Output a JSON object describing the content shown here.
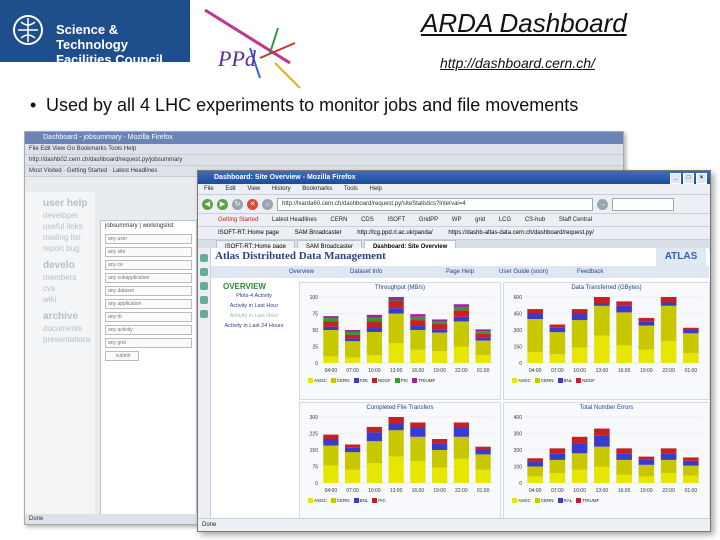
{
  "slide": {
    "org_name": "Science & Technology\nFacilities Council",
    "group_logo": "PPd",
    "title": "ARDA Dashboard",
    "url": "http://dashboard.cern.ch/",
    "bullet": "Used by all 4 LHC experiments to monitor jobs and file movements"
  },
  "back_window": {
    "title": "Dashboard - jobsummary - Mozilla Firefox",
    "menu": "File  Edit  View  Go  Bookmarks  Tools  Help",
    "address": "http://dashb02.cern.ch/dashboard/request.py/jobsummary",
    "links": [
      "Most Visited",
      "Getting Started",
      "Latest Headlines"
    ],
    "sidebar_items": [
      {
        "heading": "user help",
        "subs": [
          "developer",
          "useful links",
          "mailing list",
          "report bug"
        ]
      },
      {
        "heading": "develo",
        "subs": [
          "members",
          "cvs",
          "wiki"
        ]
      },
      {
        "heading": "archive",
        "subs": [
          "documents",
          "presentations"
        ]
      }
    ],
    "form_tabs": [
      "jobsummary",
      "workingslist"
    ],
    "form_rows": [
      "any user",
      "any site",
      "any ce",
      "any subapplication",
      "any dataset",
      "any application",
      "any rb",
      "any activity",
      "any grid"
    ],
    "submit": "submit",
    "status": "Done"
  },
  "front_window": {
    "title": "Dashboard: Site Overview - Mozilla Firefox",
    "menu": [
      "File",
      "Edit",
      "View",
      "History",
      "Bookmarks",
      "Tools",
      "Help"
    ],
    "address": "http://lxarda60.cern.ch/dashboard/request.py/siteStatistics?interval=4",
    "bookmarks": [
      "Getting Started",
      "Latest Headlines",
      "CERN",
      "CDS",
      "ISOFT",
      "GridPP",
      "WP",
      "grid",
      "LCG",
      "CS-hub",
      "Staff Central"
    ],
    "links": [
      "ISOFT-RT::Home page",
      "SAM Broadcaster",
      "http://lcg.ppd.rl.ac.uk/panda/",
      "https://dashb-atlas-data.cern.ch/dashboard/request.py/"
    ],
    "tabs": [
      {
        "label": "ISOFT-RT::Home page",
        "active": false
      },
      {
        "label": "SAM Broadcaster",
        "active": false
      },
      {
        "label": "Dashboard: Site Overview",
        "active": true
      }
    ],
    "page_title": "Atlas Distributed Data Management",
    "brand": "ATLAS",
    "nav": [
      "Overview",
      "Dataset Info",
      "Page Help",
      "User Guide (soon)",
      "Feedback"
    ],
    "overview_heading": "OVERVIEW",
    "overview_links": [
      {
        "label": "Plots-4 Activity",
        "dim": false
      },
      {
        "label": "Activity in Last Hour",
        "dim": false
      },
      {
        "label": "Activity in Last Hour",
        "dim": true
      },
      {
        "label": "Activity in Last 24 Hours",
        "dim": false
      }
    ],
    "status": "Done"
  },
  "chart_data": [
    {
      "type": "bar",
      "title": "Throughput (MB/s)",
      "categories": [
        "04:00",
        "07:00",
        "10:00",
        "13:00",
        "16:00",
        "19:00",
        "22:00",
        "01:00"
      ],
      "series": [
        {
          "name": "ASGC",
          "values": [
            10,
            8,
            12,
            30,
            20,
            18,
            25,
            12
          ]
        },
        {
          "name": "CERN",
          "values": [
            40,
            25,
            35,
            45,
            30,
            28,
            38,
            22
          ]
        },
        {
          "name": "FZK",
          "values": [
            5,
            4,
            6,
            8,
            6,
            5,
            7,
            4
          ]
        },
        {
          "name": "NDGF",
          "values": [
            8,
            6,
            10,
            12,
            9,
            8,
            10,
            6
          ]
        },
        {
          "name": "PIC",
          "values": [
            5,
            4,
            6,
            6,
            5,
            4,
            5,
            4
          ]
        },
        {
          "name": "TRIUMF",
          "values": [
            3,
            3,
            4,
            5,
            4,
            3,
            4,
            3
          ]
        }
      ],
      "ylim": [
        0,
        100
      ]
    },
    {
      "type": "bar",
      "title": "Data Transferred (GBytes)",
      "categories": [
        "04:00",
        "07:00",
        "10:00",
        "13:00",
        "16:00",
        "19:00",
        "22:00",
        "01:00"
      ],
      "series": [
        {
          "name": "ASGC",
          "values": [
            100,
            80,
            140,
            400,
            160,
            120,
            200,
            90
          ]
        },
        {
          "name": "CERN",
          "values": [
            300,
            200,
            250,
            350,
            300,
            220,
            320,
            180
          ]
        },
        {
          "name": "BNL",
          "values": [
            50,
            40,
            60,
            80,
            60,
            40,
            70,
            30
          ]
        },
        {
          "name": "NDGF",
          "values": [
            40,
            30,
            40,
            60,
            40,
            30,
            50,
            20
          ]
        }
      ],
      "ylim": [
        0,
        600
      ]
    },
    {
      "type": "bar",
      "title": "Completed File Transfers",
      "categories": [
        "04:00",
        "07:00",
        "10:00",
        "13:00",
        "16:00",
        "19:00",
        "22:00",
        "01:00"
      ],
      "series": [
        {
          "name": "ASGC",
          "values": [
            80,
            60,
            90,
            120,
            100,
            70,
            110,
            60
          ]
        },
        {
          "name": "CERN",
          "values": [
            90,
            80,
            100,
            120,
            110,
            80,
            100,
            70
          ]
        },
        {
          "name": "BNL",
          "values": [
            30,
            20,
            40,
            50,
            40,
            30,
            40,
            20
          ]
        },
        {
          "name": "PIC",
          "values": [
            20,
            15,
            25,
            30,
            25,
            20,
            25,
            15
          ]
        }
      ],
      "ylim": [
        0,
        300
      ]
    },
    {
      "type": "bar",
      "title": "Total Number Errors",
      "categories": [
        "04:00",
        "07:00",
        "10:00",
        "13:00",
        "16:00",
        "19:00",
        "22:00",
        "01:00"
      ],
      "series": [
        {
          "name": "ASGC",
          "values": [
            40,
            60,
            80,
            100,
            50,
            40,
            60,
            45
          ]
        },
        {
          "name": "CERN",
          "values": [
            60,
            80,
            100,
            120,
            90,
            70,
            80,
            60
          ]
        },
        {
          "name": "RAL",
          "values": [
            30,
            40,
            60,
            70,
            40,
            30,
            40,
            30
          ]
        },
        {
          "name": "TRIUMF",
          "values": [
            20,
            30,
            40,
            40,
            30,
            20,
            30,
            20
          ]
        }
      ],
      "ylim": [
        0,
        400
      ]
    }
  ],
  "colors": {
    "stfc_blue": "#1f4e8c",
    "atlas_blue": "#2c3f8a",
    "series": [
      "#e6e600",
      "#c8c800",
      "#3a3acb",
      "#c82020",
      "#2aa02a",
      "#a020a0"
    ]
  }
}
